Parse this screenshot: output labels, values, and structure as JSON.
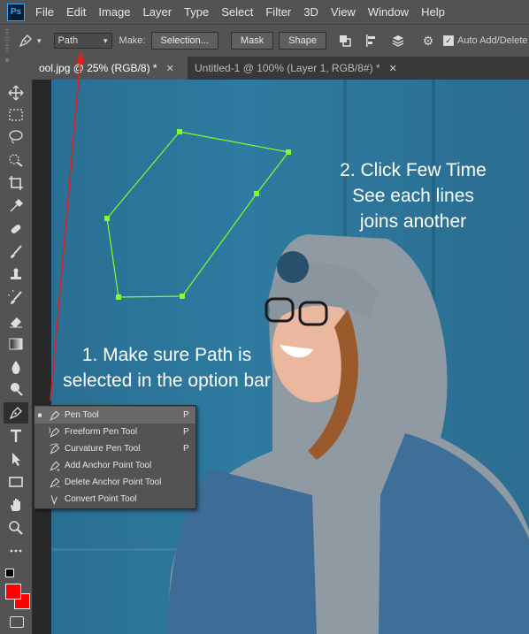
{
  "app": {
    "logo_text": "Ps"
  },
  "menu": [
    "File",
    "Edit",
    "Image",
    "Layer",
    "Type",
    "Select",
    "Filter",
    "3D",
    "View",
    "Window",
    "Help"
  ],
  "options": {
    "mode_select": "Path",
    "make_label": "Make:",
    "selection_btn": "Selection...",
    "mask_btn": "Mask",
    "shape_btn": "Shape",
    "auto_add_delete_label": "Auto Add/Delete",
    "auto_add_delete_checked": true
  },
  "tabs": [
    {
      "label": "ool.jpg @ 25% (RGB/8) *",
      "close": "✕"
    },
    {
      "label": "Untitled-1 @ 100% (Layer 1, RGB/8#) *",
      "close": "✕"
    }
  ],
  "toolbar": {
    "collapse": "»",
    "foreground_color": "#ff0000",
    "background_color": "#ff0000",
    "tools": [
      "move",
      "marquee",
      "lasso",
      "quick-select",
      "crop",
      "eyedropper",
      "healing",
      "brush",
      "clone-stamp",
      "history-brush",
      "eraser",
      "gradient",
      "blur",
      "dodge",
      "pen",
      "type",
      "path-select",
      "rectangle",
      "hand",
      "zoom",
      "more"
    ]
  },
  "annotations": {
    "step1_line1": "1. Make sure Path is",
    "step1_line2": "selected in the option bar",
    "step2_line1": "2. Click Few Time",
    "step2_line2": "See each lines",
    "step2_line3": "joins another"
  },
  "flyout": [
    {
      "label": "Pen Tool",
      "key": "P",
      "selected": true
    },
    {
      "label": "Freeform Pen Tool",
      "key": "P",
      "selected": false
    },
    {
      "label": "Curvature Pen Tool",
      "key": "P",
      "selected": false
    },
    {
      "label": "Add Anchor Point Tool",
      "key": "",
      "selected": false
    },
    {
      "label": "Delete Anchor Point Tool",
      "key": "",
      "selected": false
    },
    {
      "label": "Convert Point Tool",
      "key": "",
      "selected": false
    }
  ],
  "colors": {
    "path_color": "#7fff2a",
    "arrow_color": "#e02020",
    "accent": "#31a8ff"
  }
}
